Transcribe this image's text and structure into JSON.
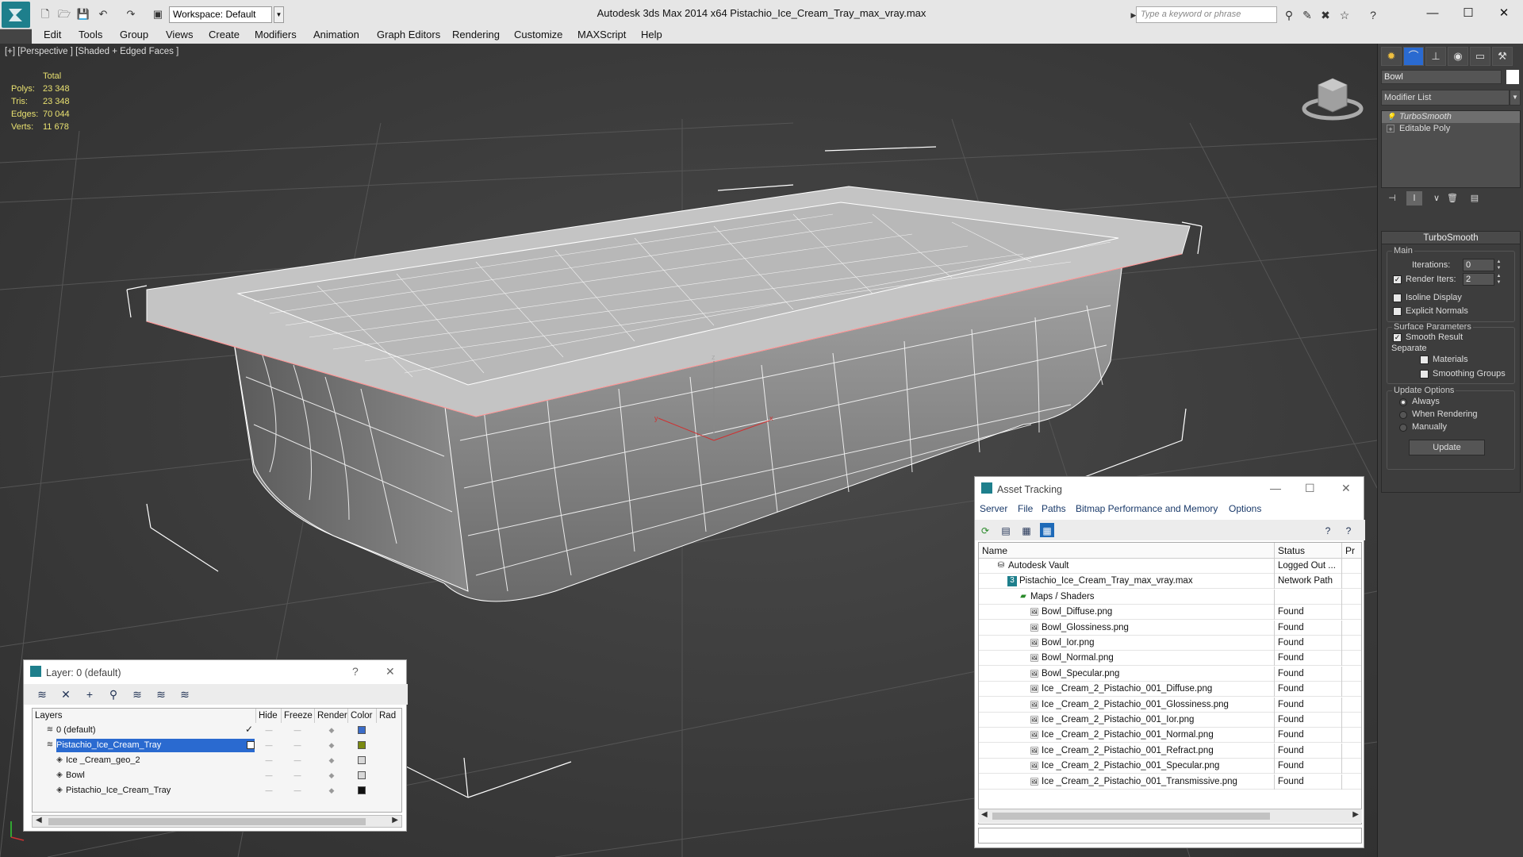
{
  "window": {
    "title": "Autodesk 3ds Max  2014 x64       Pistachio_Ice_Cream_Tray_max_vray.max",
    "workspace": "Workspace: Default",
    "search_placeholder": "Type a keyword or phrase",
    "minimize": "—",
    "maximize": "☐",
    "close": "✕"
  },
  "menu": [
    "Edit",
    "Tools",
    "Group",
    "Views",
    "Create",
    "Modifiers",
    "Animation",
    "Graph Editors",
    "Rendering",
    "Customize",
    "MAXScript",
    "Help"
  ],
  "viewport": {
    "label": "[+] [Perspective ] [Shaded + Edged Faces ]",
    "stats_header": "Total",
    "stats": [
      {
        "label": "Polys:",
        "value": "23 348"
      },
      {
        "label": "Tris:",
        "value": "23 348"
      },
      {
        "label": "Edges:",
        "value": "70 044"
      },
      {
        "label": "Verts:",
        "value": "11 678"
      }
    ]
  },
  "command_panel": {
    "object_name": "Bowl",
    "modifier_list": "Modifier List",
    "stack": [
      {
        "label": "TurboSmooth",
        "selected": true,
        "icon": "lightbulb-icon"
      },
      {
        "label": "Editable Poly",
        "selected": false,
        "icon": "plus-icon"
      }
    ],
    "rollout_title": "TurboSmooth",
    "main_group": "Main",
    "iterations_label": "Iterations:",
    "iterations_value": "0",
    "render_iters_label": "Render Iters:",
    "render_iters_value": "2",
    "render_iters_checked": true,
    "isoline_label": "Isoline Display",
    "explicit_normals_label": "Explicit Normals",
    "surface_group": "Surface Parameters",
    "smooth_result_label": "Smooth Result",
    "separate_label": "Separate",
    "materials_label": "Materials",
    "smoothing_groups_label": "Smoothing Groups",
    "update_group": "Update Options",
    "always_label": "Always",
    "when_rendering_label": "When Rendering",
    "manually_label": "Manually",
    "update_button": "Update"
  },
  "layer_dialog": {
    "title": "Layer: 0 (default)",
    "help": "?",
    "close": "✕",
    "columns": [
      "Layers",
      "Hide",
      "Freeze",
      "Render",
      "Color",
      "Rad"
    ],
    "rows": [
      {
        "name": "0 (default)",
        "indent": 1,
        "selected": false,
        "active": true,
        "color": "#3a6cc8"
      },
      {
        "name": "Pistachio_Ice_Cream_Tray",
        "indent": 1,
        "selected": true,
        "active": false,
        "color": "#7a8a10"
      },
      {
        "name": "Ice _Cream_geo_2",
        "indent": 2,
        "selected": false,
        "active": false,
        "color": "#d8d8d8"
      },
      {
        "name": "Bowl",
        "indent": 2,
        "selected": false,
        "active": false,
        "color": "#d8d8d8"
      },
      {
        "name": "Pistachio_Ice_Cream_Tray",
        "indent": 2,
        "selected": false,
        "active": false,
        "color": "#111111"
      }
    ]
  },
  "asset_dialog": {
    "title": "Asset Tracking",
    "menu": [
      "Server",
      "File",
      "Paths",
      "Bitmap Performance and Memory",
      "Options"
    ],
    "columns": [
      "Name",
      "Status",
      "Pr"
    ],
    "rows": [
      {
        "name": "Autodesk Vault",
        "status": "Logged Out ...",
        "indent": 1,
        "icon": "vault-icon"
      },
      {
        "name": "Pistachio_Ice_Cream_Tray_max_vray.max",
        "status": "Network Path",
        "indent": 2,
        "icon": "max-file-icon"
      },
      {
        "name": "Maps / Shaders",
        "status": "",
        "indent": 3,
        "icon": "maps-icon"
      },
      {
        "name": "Bowl_Diffuse.png",
        "status": "Found",
        "indent": 4,
        "icon": "bitmap-icon"
      },
      {
        "name": "Bowl_Glossiness.png",
        "status": "Found",
        "indent": 4,
        "icon": "bitmap-icon"
      },
      {
        "name": "Bowl_Ior.png",
        "status": "Found",
        "indent": 4,
        "icon": "bitmap-icon"
      },
      {
        "name": "Bowl_Normal.png",
        "status": "Found",
        "indent": 4,
        "icon": "bitmap-icon"
      },
      {
        "name": "Bowl_Specular.png",
        "status": "Found",
        "indent": 4,
        "icon": "bitmap-icon"
      },
      {
        "name": "Ice _Cream_2_Pistachio_001_Diffuse.png",
        "status": "Found",
        "indent": 4,
        "icon": "bitmap-icon"
      },
      {
        "name": "Ice _Cream_2_Pistachio_001_Glossiness.png",
        "status": "Found",
        "indent": 4,
        "icon": "bitmap-icon"
      },
      {
        "name": "Ice _Cream_2_Pistachio_001_Ior.png",
        "status": "Found",
        "indent": 4,
        "icon": "bitmap-icon"
      },
      {
        "name": "Ice _Cream_2_Pistachio_001_Normal.png",
        "status": "Found",
        "indent": 4,
        "icon": "bitmap-icon"
      },
      {
        "name": "Ice _Cream_2_Pistachio_001_Refract.png",
        "status": "Found",
        "indent": 4,
        "icon": "bitmap-icon"
      },
      {
        "name": "Ice _Cream_2_Pistachio_001_Specular.png",
        "status": "Found",
        "indent": 4,
        "icon": "bitmap-icon"
      },
      {
        "name": "Ice _Cream_2_Pistachio_001_Transmissive.png",
        "status": "Found",
        "indent": 4,
        "icon": "bitmap-icon"
      }
    ]
  }
}
